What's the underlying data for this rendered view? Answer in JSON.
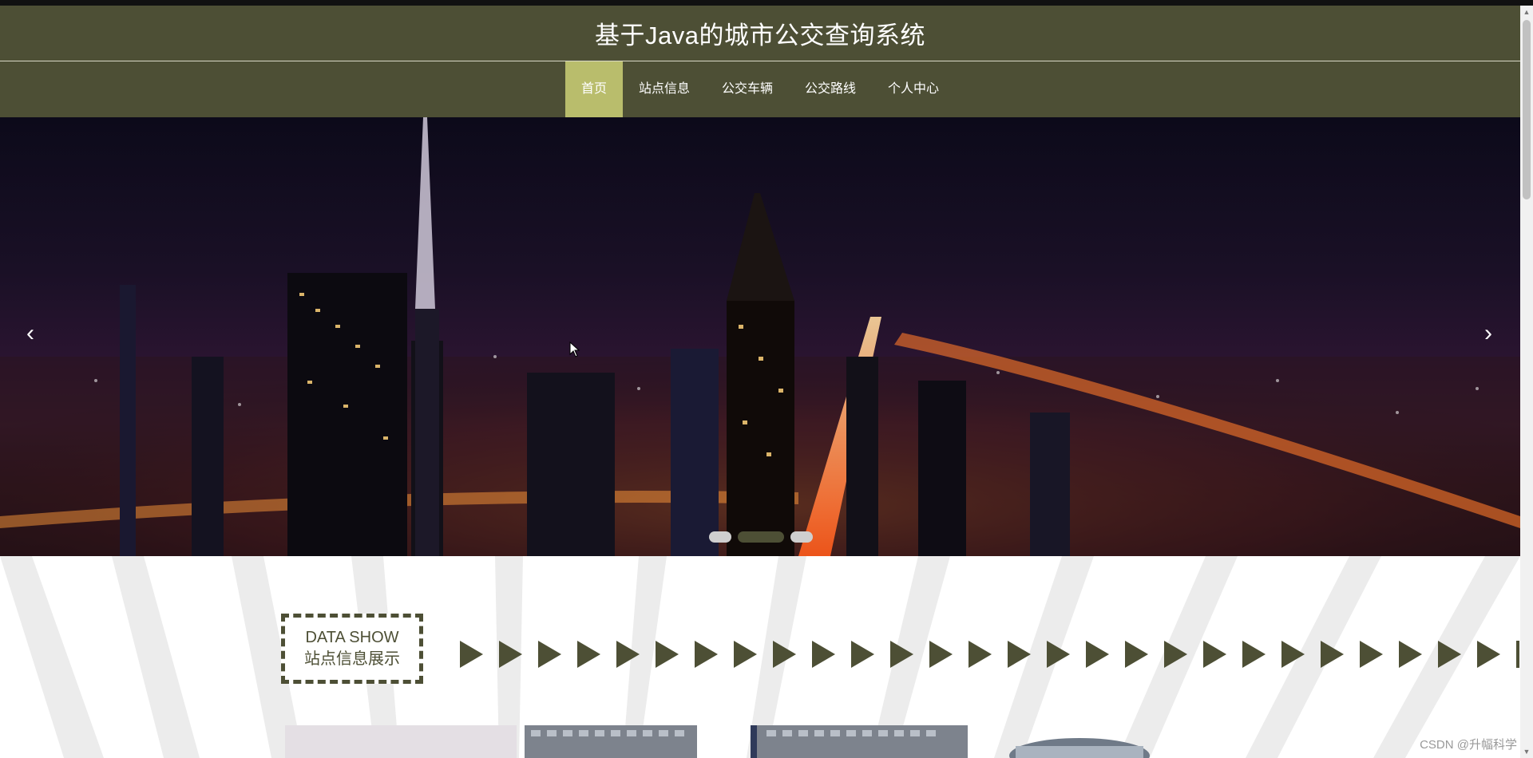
{
  "header": {
    "title": "基于Java的城市公交查询系统"
  },
  "nav": {
    "items": [
      {
        "label": "首页",
        "active": true
      },
      {
        "label": "站点信息",
        "active": false
      },
      {
        "label": "公交车辆",
        "active": false
      },
      {
        "label": "公交路线",
        "active": false
      },
      {
        "label": "个人中心",
        "active": false
      }
    ]
  },
  "carousel": {
    "prev_icon": "chevron-left-icon",
    "next_icon": "chevron-right-icon",
    "slide_count": 3,
    "active_slide": 2
  },
  "section": {
    "title_en": "DATA SHOW",
    "title_cn": "站点信息展示"
  },
  "watermark": "CSDN @升幅科学",
  "colors": {
    "primary": "#4d4f35",
    "accent": "#b9bd6c",
    "background": "#ffffff"
  }
}
